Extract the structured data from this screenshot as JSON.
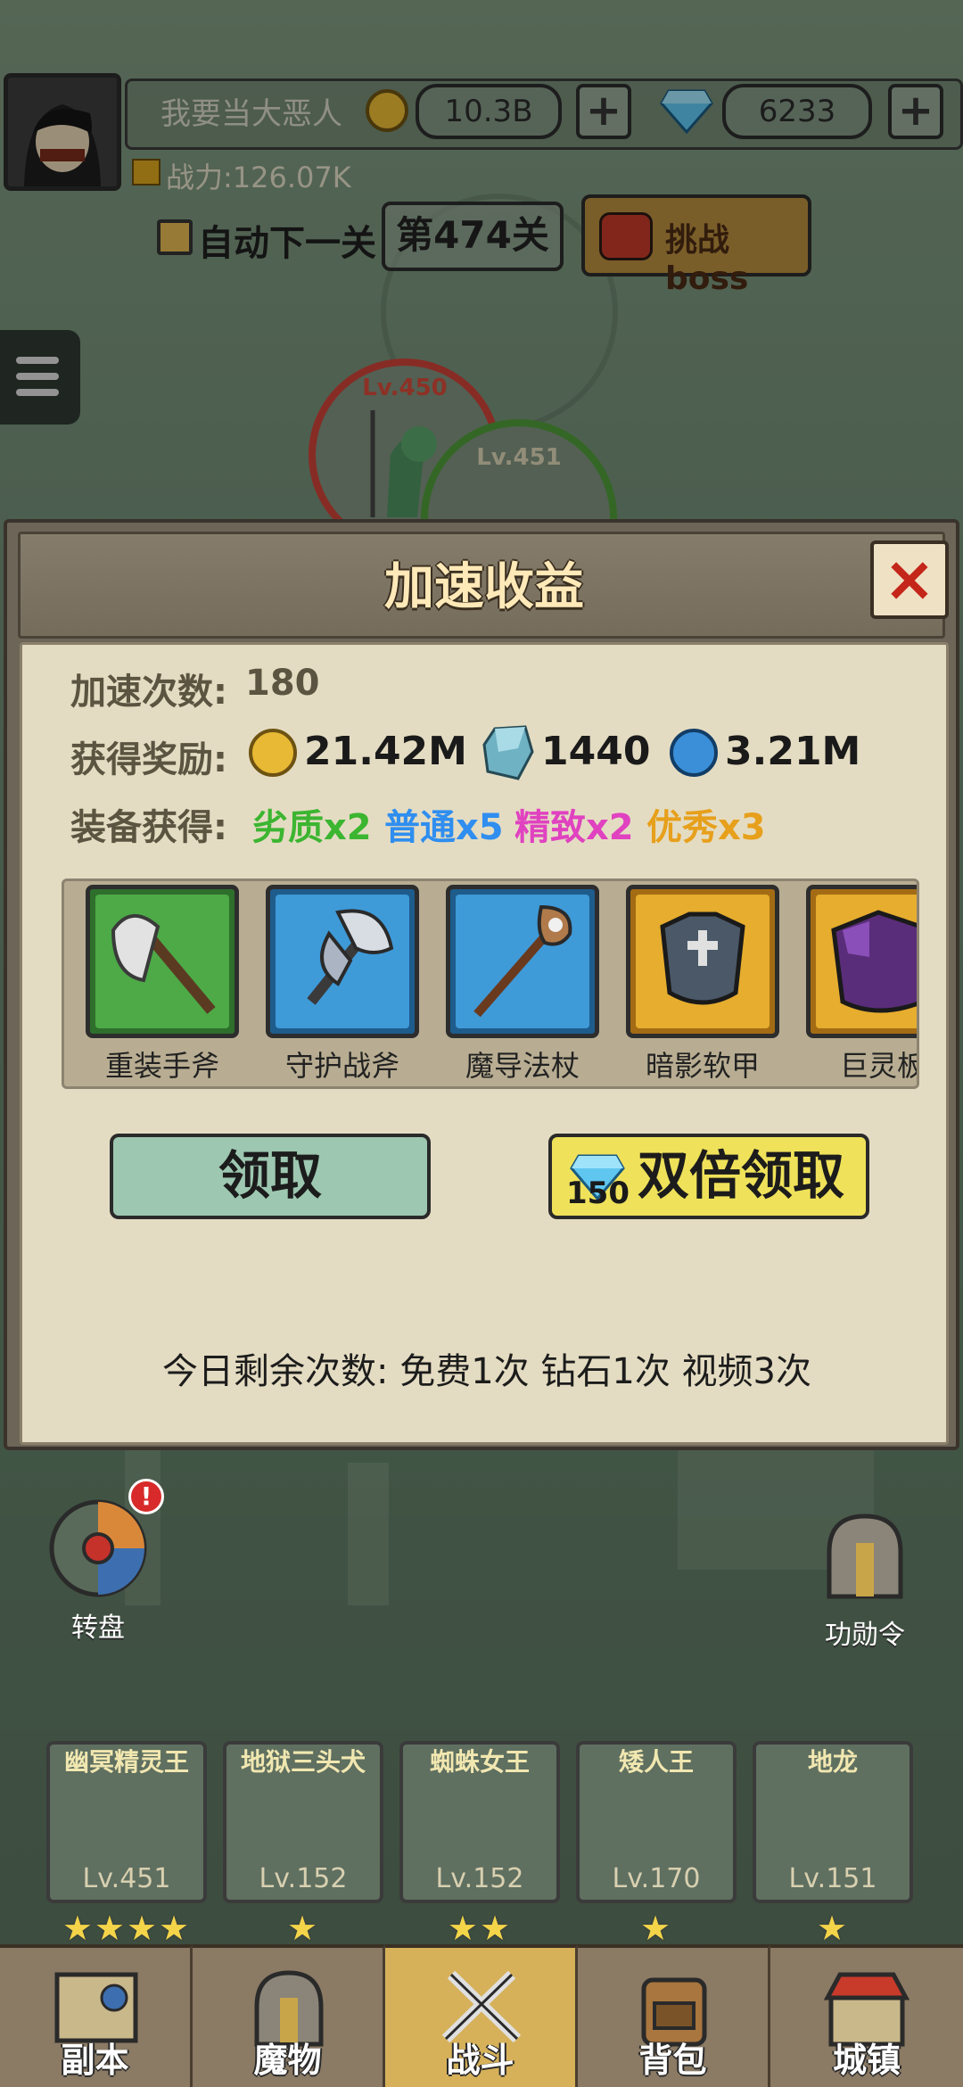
{
  "player": {
    "name": "我要当大恶人",
    "power": "战力:126.07K"
  },
  "currency": {
    "gold": "10.3B",
    "diamond": "6233",
    "plus": "+"
  },
  "stage": {
    "auto_next": "自动下一关",
    "level": "第474关",
    "boss": "挑战boss"
  },
  "battle": {
    "enemy_lv": "Lv.450",
    "hero_lv": "Lv.451"
  },
  "dialog": {
    "title": "加速收益",
    "close": "×",
    "count_label": "加速次数:",
    "count_value": "180",
    "reward_label": "获得奖励:",
    "rewards": [
      "21.42M",
      "1440",
      "3.21M"
    ],
    "equip_label": "装备获得:",
    "equip": [
      {
        "text": "劣质x2",
        "color": "#3cb531"
      },
      {
        "text": "普通x5",
        "color": "#2f8ef0"
      },
      {
        "text": "精致x2",
        "color": "#e042c0"
      },
      {
        "text": "优秀x3",
        "color": "#e7a01c"
      }
    ],
    "items": [
      "重装手斧",
      "守护战斧",
      "魔导法杖",
      "暗影软甲",
      "巨灵板"
    ],
    "claim": "领取",
    "double_cost": "150",
    "double_claim": "双倍领取",
    "remaining": "今日剩余次数:  免费1次  钻石1次  视频3次"
  },
  "side": {
    "wheel": "转盘",
    "merit": "功勋令"
  },
  "heroes": [
    {
      "name": "幽冥精灵王",
      "lv": "Lv.451",
      "stars": "★★★★"
    },
    {
      "name": "地狱三头犬",
      "lv": "Lv.152",
      "stars": "★"
    },
    {
      "name": "蜘蛛女王",
      "lv": "Lv.152",
      "stars": "★★"
    },
    {
      "name": "矮人王",
      "lv": "Lv.170",
      "stars": "★"
    },
    {
      "name": "地龙",
      "lv": "Lv.151",
      "stars": "★"
    }
  ],
  "nav": [
    "副本",
    "魔物",
    "战斗",
    "背包",
    "城镇"
  ],
  "colors": {
    "dialog_body": "#e4dcc2",
    "claim_btn": "#9dc7b0",
    "double_btn": "#efe25a",
    "close_x": "#c4261a"
  }
}
